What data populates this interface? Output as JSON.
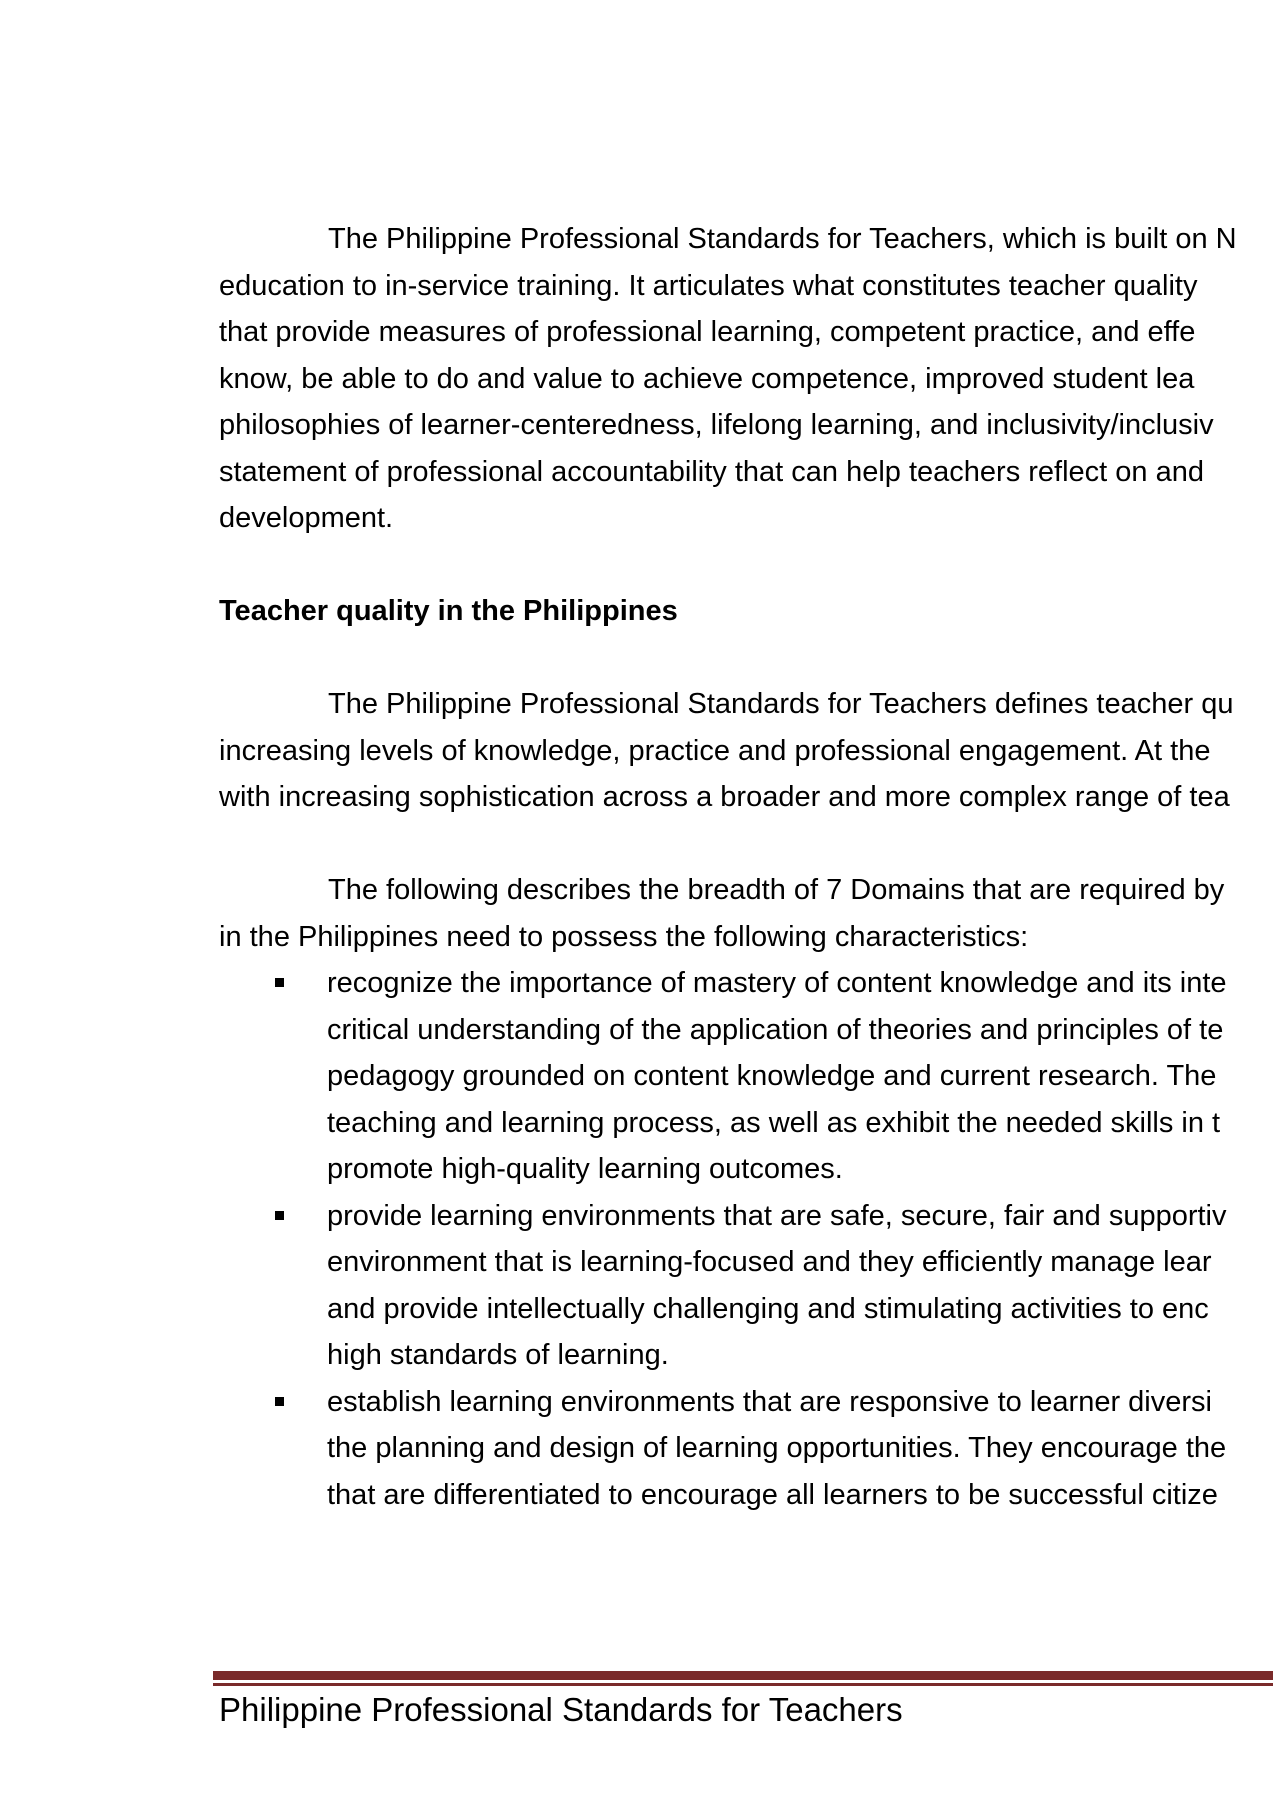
{
  "intro_paragraph": [
    "The Philippine Professional Standards for Teachers, which is built on N",
    "education to in-service training. It articulates what constitutes teacher quality",
    "that provide measures of professional learning, competent practice, and effe",
    "know, be able to do and value to achieve competence, improved student lea",
    "philosophies of learner-centeredness, lifelong learning, and inclusivity/inclusiv",
    "statement of professional accountability that can help teachers reflect on and",
    "development."
  ],
  "section_heading": "Teacher quality in the Philippines",
  "quality_paragraph": [
    "The Philippine Professional Standards for Teachers defines teacher qu",
    "increasing levels of knowledge, practice and professional engagement. At the",
    "with increasing sophistication across a broader and more complex range of tea"
  ],
  "domains_paragraph": [
    "The following describes the breadth of 7 Domains that are required by",
    "in the Philippines need to possess the following characteristics:"
  ],
  "bullets": [
    [
      "recognize the importance of mastery of content knowledge and its inte",
      "critical understanding of the application of theories and principles of te",
      "pedagogy grounded on content knowledge and current research. The",
      "teaching and learning process, as well as exhibit the needed skills in t",
      "promote high-quality learning outcomes."
    ],
    [
      "provide learning environments that are safe, secure, fair and supportiv",
      "environment that is learning-focused and they efficiently manage lear",
      "and provide intellectually challenging and stimulating activities to enc",
      "high standards of learning."
    ],
    [
      "establish learning environments that are responsive to learner diversi",
      "the planning and design of learning opportunities. They encourage the",
      "that are differentiated to encourage all learners to be successful citize"
    ]
  ],
  "footer": {
    "title": "Philippine Professional Standards for Teachers",
    "rule_color": "#7a2a2a"
  }
}
